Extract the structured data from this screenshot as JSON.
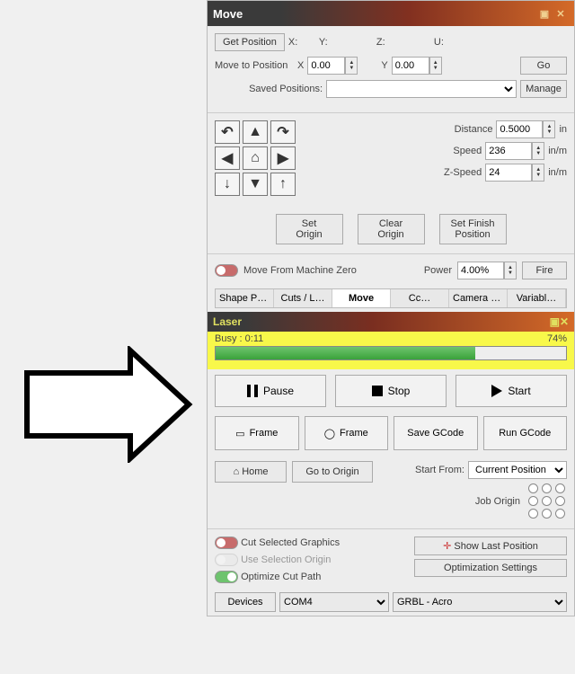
{
  "move_panel": {
    "title": "Move",
    "get_position": "Get Position",
    "coord_labels": {
      "x": "X:",
      "y": "Y:",
      "z": "Z:",
      "u": "U:"
    },
    "move_to_position": "Move to Position",
    "xfield_label": "X",
    "yfield_label": "Y",
    "x_value": "0.00",
    "y_value": "0.00",
    "go": "Go",
    "saved_positions": "Saved Positions:",
    "manage": "Manage",
    "distance_label": "Distance",
    "distance_value": "0.5000",
    "distance_unit": "in",
    "speed_label": "Speed",
    "speed_value": "236",
    "speed_unit": "in/m",
    "zspeed_label": "Z-Speed",
    "zspeed_value": "24",
    "zspeed_unit": "in/m",
    "set_origin": "Set\nOrigin",
    "clear_origin": "Clear\nOrigin",
    "set_finish": "Set Finish\nPosition",
    "move_from_zero": "Move From Machine Zero",
    "power_label": "Power",
    "power_value": "4.00%",
    "fire": "Fire"
  },
  "tabs": [
    "Shape Prop…",
    "Cuts / L…",
    "Move",
    "Cc…",
    "Camera C…",
    "Variabl…"
  ],
  "laser_panel": {
    "title": "Laser",
    "busy_label": "Busy :",
    "busy_time": "0:11",
    "percent": "74%",
    "progress_width": "74%",
    "pause": "Pause",
    "stop": "Stop",
    "start": "Start",
    "frame1": "Frame",
    "frame2": "Frame",
    "save_gcode": "Save GCode",
    "run_gcode": "Run GCode",
    "home": "Home",
    "go_to_origin": "Go to Origin",
    "start_from": "Start From:",
    "start_from_value": "Current Position",
    "job_origin": "Job Origin",
    "cut_selected": "Cut Selected Graphics",
    "use_selection_origin": "Use Selection Origin",
    "optimize_cut_path": "Optimize Cut Path",
    "show_last_position": "Show Last Position",
    "optimization_settings": "Optimization Settings",
    "devices": "Devices",
    "port": "COM4",
    "controller": "GRBL - Acro"
  }
}
